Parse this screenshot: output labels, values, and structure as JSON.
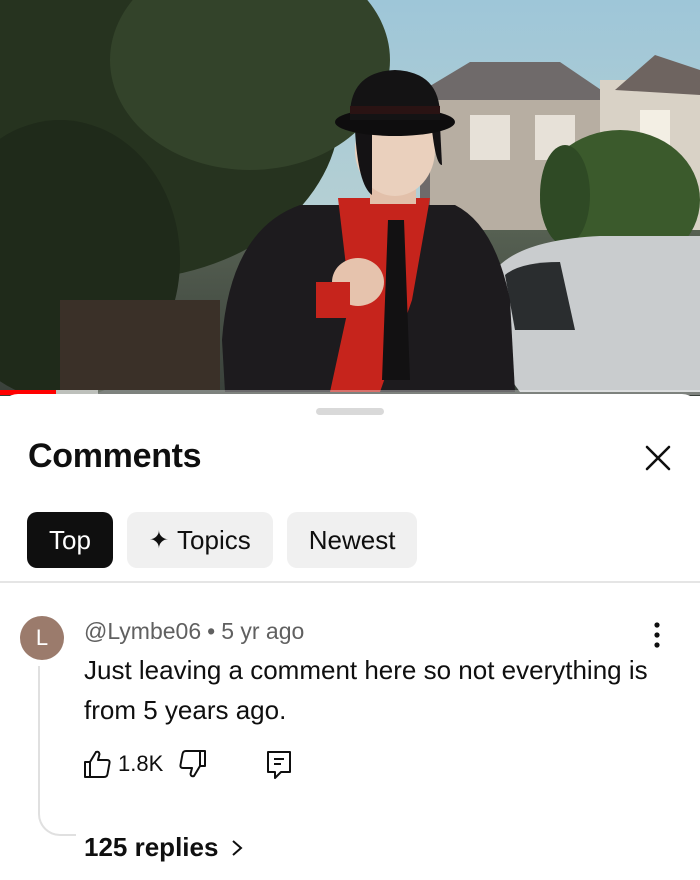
{
  "video": {
    "progress_fraction": 0.08,
    "buffered_fraction": 0.14
  },
  "comments_panel": {
    "title": "Comments",
    "close_icon": "close-icon"
  },
  "filters": {
    "chips": [
      {
        "label": "Top",
        "selected": true
      },
      {
        "label": "Topics",
        "icon": "sparkle-icon",
        "icon_glyph": "✦"
      },
      {
        "label": "Newest"
      }
    ]
  },
  "comment": {
    "avatar_letter": "L",
    "avatar_color": "#9b7b6c",
    "author": "@Lymbe06",
    "separator": "•",
    "time": "5 yr ago",
    "text": "Just leaving a comment here so not everything is from 5 years ago.",
    "likes": "1.8K",
    "replies_label": "125 replies"
  },
  "colors": {
    "accent": "#ff0000",
    "chip_selected_bg": "#0f0f0f",
    "chip_bg": "#f0f0f0",
    "secondary_text": "#606060"
  }
}
